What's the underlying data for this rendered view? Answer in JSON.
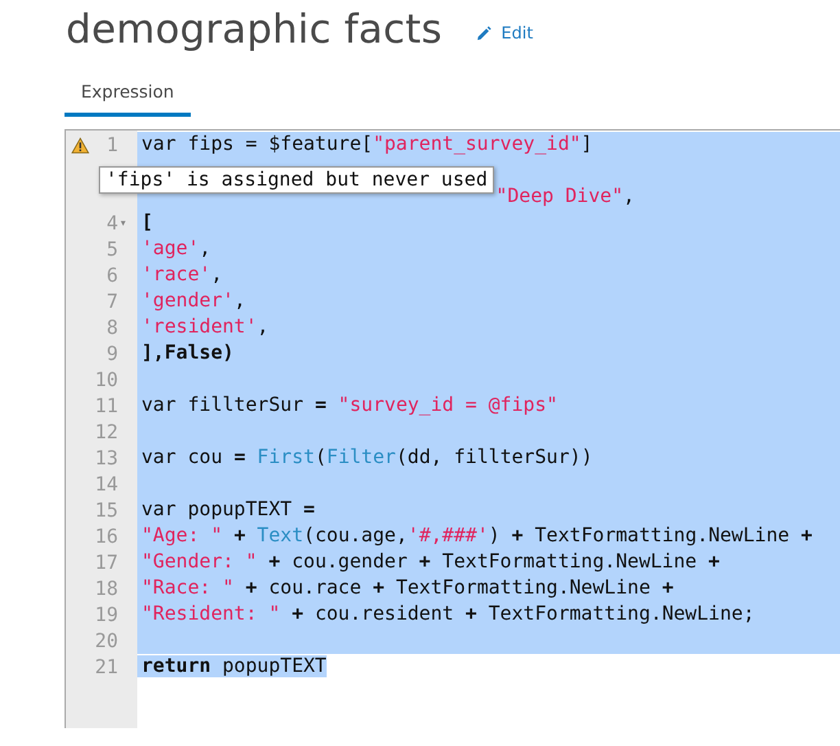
{
  "title": "demographic facts",
  "edit_link": "Edit",
  "tabs": [
    {
      "label": "Expression",
      "selected": true
    }
  ],
  "editor": {
    "tooltip": "'fips' is assigned but never used",
    "lines": [
      {
        "number": "1",
        "warning": true,
        "selected": true,
        "tokens": [
          {
            "kind": "plain",
            "text": "var fips = $feature["
          },
          {
            "kind": "string",
            "text": "\"parent_survey_id\""
          },
          {
            "kind": "plain",
            "text": "]"
          }
        ]
      },
      {
        "covered": true,
        "selected": true
      },
      {
        "covered": true,
        "selected": true,
        "tokens": [
          {
            "kind": "string",
            "text": "\"Deep Dive\""
          },
          {
            "kind": "plain",
            "text": ","
          }
        ]
      },
      {
        "number": "4",
        "fold": "▾",
        "selected": true,
        "tokens": [
          {
            "kind": "bold",
            "text": "["
          }
        ]
      },
      {
        "number": "5",
        "selected": true,
        "tokens": [
          {
            "kind": "string",
            "text": "'age'"
          },
          {
            "kind": "plain",
            "text": ","
          }
        ]
      },
      {
        "number": "6",
        "selected": true,
        "tokens": [
          {
            "kind": "string",
            "text": "'race'"
          },
          {
            "kind": "plain",
            "text": ","
          }
        ]
      },
      {
        "number": "7",
        "selected": true,
        "tokens": [
          {
            "kind": "string",
            "text": "'gender'"
          },
          {
            "kind": "plain",
            "text": ","
          }
        ]
      },
      {
        "number": "8",
        "selected": true,
        "tokens": [
          {
            "kind": "string",
            "text": "'resident'"
          },
          {
            "kind": "plain",
            "text": ","
          }
        ]
      },
      {
        "number": "9",
        "selected": true,
        "tokens": [
          {
            "kind": "bold",
            "text": "],False)"
          }
        ]
      },
      {
        "number": "10",
        "selected": true
      },
      {
        "number": "11",
        "selected": true,
        "tokens": [
          {
            "kind": "plain",
            "text": "var fillterSur "
          },
          {
            "kind": "bold",
            "text": "="
          },
          {
            "kind": "string",
            "text": " \"survey_id = @fips\""
          }
        ]
      },
      {
        "number": "12",
        "selected": true
      },
      {
        "number": "13",
        "selected": true,
        "tokens": [
          {
            "kind": "plain",
            "text": "var cou "
          },
          {
            "kind": "bold",
            "text": "="
          },
          {
            "kind": "function",
            "text": " First"
          },
          {
            "kind": "plain",
            "text": "("
          },
          {
            "kind": "function",
            "text": "Filter"
          },
          {
            "kind": "plain",
            "text": "(dd, fillterSur))"
          }
        ]
      },
      {
        "number": "14",
        "selected": true
      },
      {
        "number": "15",
        "selected": true,
        "tokens": [
          {
            "kind": "plain",
            "text": "var popupTEXT "
          },
          {
            "kind": "bold",
            "text": "="
          }
        ]
      },
      {
        "number": "16",
        "selected": true,
        "tokens": [
          {
            "kind": "string",
            "text": "\"Age: \""
          },
          {
            "kind": "bold",
            "text": " +"
          },
          {
            "kind": "function",
            "text": " Text"
          },
          {
            "kind": "plain",
            "text": "(cou.age,"
          },
          {
            "kind": "string",
            "text": "'#,###'"
          },
          {
            "kind": "plain",
            "text": ")"
          },
          {
            "kind": "bold",
            "text": " +"
          },
          {
            "kind": "plain",
            "text": " TextFormatting.NewLine"
          },
          {
            "kind": "bold",
            "text": " +"
          }
        ]
      },
      {
        "number": "17",
        "selected": true,
        "tokens": [
          {
            "kind": "string",
            "text": "\"Gender: \""
          },
          {
            "kind": "bold",
            "text": " +"
          },
          {
            "kind": "plain",
            "text": " cou.gender"
          },
          {
            "kind": "bold",
            "text": " +"
          },
          {
            "kind": "plain",
            "text": " TextFormatting.NewLine"
          },
          {
            "kind": "bold",
            "text": " +"
          }
        ]
      },
      {
        "number": "18",
        "selected": true,
        "tokens": [
          {
            "kind": "string",
            "text": "\"Race: \""
          },
          {
            "kind": "bold",
            "text": " +"
          },
          {
            "kind": "plain",
            "text": " cou.race"
          },
          {
            "kind": "bold",
            "text": " +"
          },
          {
            "kind": "plain",
            "text": " TextFormatting.NewLine"
          },
          {
            "kind": "bold",
            "text": " +"
          }
        ]
      },
      {
        "number": "19",
        "selected": true,
        "tokens": [
          {
            "kind": "string",
            "text": "\"Resident: \""
          },
          {
            "kind": "bold",
            "text": " +"
          },
          {
            "kind": "plain",
            "text": " cou.resident"
          },
          {
            "kind": "bold",
            "text": " +"
          },
          {
            "kind": "plain",
            "text": " TextFormatting.NewLine;"
          }
        ]
      },
      {
        "number": "20",
        "selected": true
      },
      {
        "number": "21",
        "selected": true,
        "tokens": [
          {
            "kind": "bold",
            "text": "return"
          },
          {
            "kind": "plain",
            "text": " popupTEXT"
          }
        ]
      }
    ]
  }
}
